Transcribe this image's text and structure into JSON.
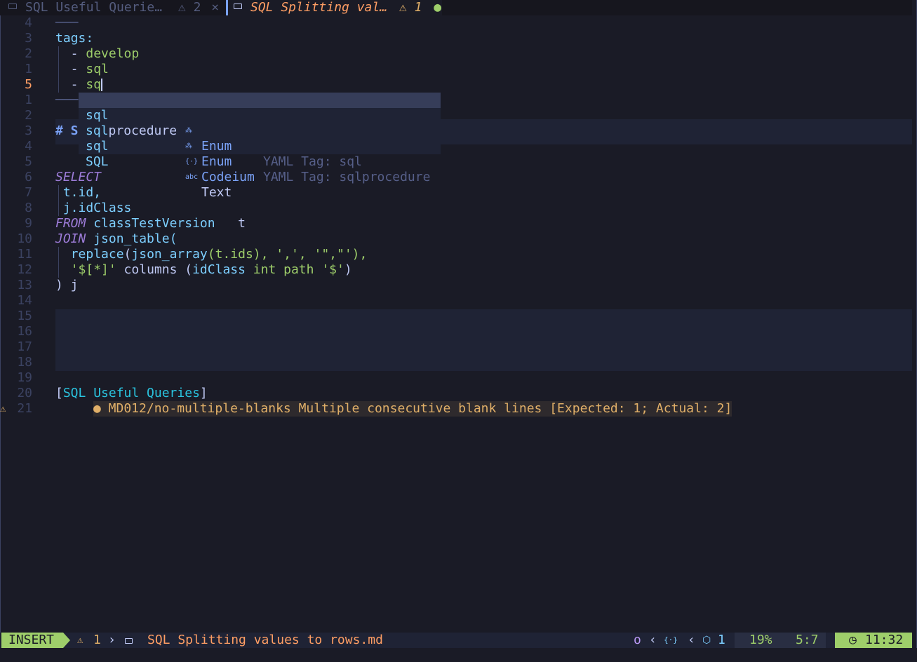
{
  "tabs": [
    {
      "name": "SQL Useful Querie…",
      "warn_icon": "⚠",
      "warn_count": "2",
      "close": "×"
    },
    {
      "name": "SQL Splitting val…",
      "warn_icon": "⚠",
      "warn_count": "1",
      "modified": "●"
    }
  ],
  "line_numbers": [
    "4",
    "3",
    "2",
    "1",
    "5",
    "1",
    "2",
    "3",
    "4",
    "5",
    "6",
    "7",
    "8",
    "9",
    "10",
    "11",
    "12",
    "13",
    "14",
    "15",
    "16",
    "17",
    "18",
    "19",
    "20",
    "21"
  ],
  "lines": {
    "l0": "───",
    "l1": "tags:",
    "l2_dash": "  - ",
    "l2_val": "develop",
    "l3_dash": "  - ",
    "l3_val": "sql",
    "l4_dash": "  - ",
    "l4_val": "sq",
    "l5": "───",
    "l6": "# S",
    "l10": "SELECT",
    "l11": " t.id,",
    "l12": " j.idClass",
    "l13_kw": "FROM",
    "l13_tbl": "classTestVersion",
    "l13_alias": "t",
    "l14_kw": "JOIN",
    "l14_fn": "json_table(",
    "l15_fn": "replace",
    "l15_mid": "(",
    "l15_fn2": "json_array",
    "l15_rest": "(t.ids), ',', '\",\"'),",
    "l16_str": "'$[*]'",
    "l16_rest": " columns (",
    "l16_col": "idClass",
    "l16_ty": " int path ",
    "l16_str2": "'$'",
    "l16_end": ")",
    "l17": ") j",
    "l24_open": "[",
    "l24_text": "SQL Useful Queries",
    "l24_close": "]",
    "diag": "● MD012/no-multiple-blanks Multiple consecutive blank lines [Expected: 1; Actual: 2]",
    "diag_sign": "⚠"
  },
  "completion": [
    {
      "word_match": "sql",
      "word_rest": "",
      "icon": "⁂",
      "kind": "Enum",
      "detail": "YAML Tag: sql"
    },
    {
      "word_match": "sql",
      "word_rest": "procedure",
      "icon": "⁂",
      "kind": "Enum",
      "detail": "YAML Tag: sqlprocedure"
    },
    {
      "word_match": "sql",
      "word_rest": "",
      "icon": "{·}",
      "kind": "Codeium",
      "detail": ""
    },
    {
      "word_match": "SQL",
      "word_rest": "",
      "icon": "abc",
      "kind": "Text",
      "detail": ""
    }
  ],
  "statusline": {
    "mode": "INSERT",
    "warn_icon": "⚠",
    "warn_count": "1",
    "filename": "SQL Splitting values to rows.md",
    "indicator": "o",
    "lsp_count": "1",
    "percent": "19%",
    "position": "5:7",
    "clock_icon": "◷",
    "time": "11:32"
  },
  "colors": {
    "accent": "#7aa2f7",
    "mode_bg": "#9ece6a",
    "warning": "#e0af68",
    "background": "#1a1b26"
  }
}
